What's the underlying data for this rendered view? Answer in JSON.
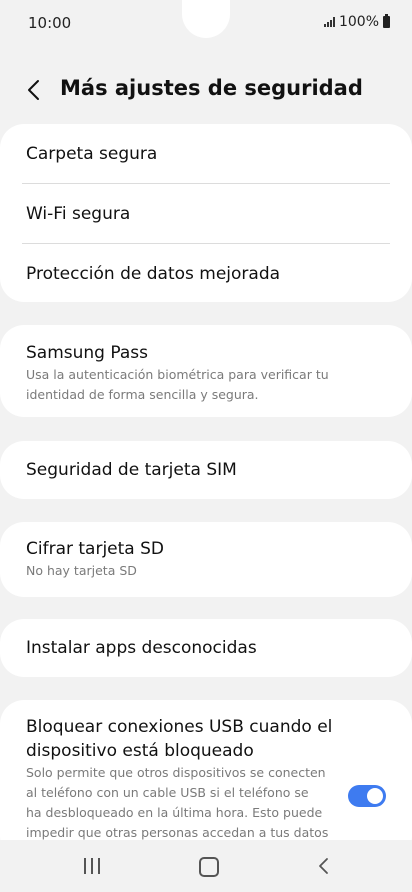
{
  "status_bar": {
    "time": "10:00",
    "battery_text": "100%"
  },
  "header": {
    "title": "Más ajustes de seguridad",
    "back_icon": "chevron-left-icon"
  },
  "group1": {
    "items": [
      {
        "title": "Carpeta segura"
      },
      {
        "title": "Wi-Fi segura"
      },
      {
        "title": "Protección de datos mejorada"
      }
    ]
  },
  "samsung_pass": {
    "title": "Samsung Pass",
    "subtitle_line1": "Usa la autenticación biométrica para verificar tu",
    "subtitle_line2": "identidad de forma sencilla y segura."
  },
  "sim_security": {
    "title": "Seguridad de tarjeta SIM"
  },
  "sd_encrypt": {
    "title": "Cifrar tarjeta SD",
    "subtitle": "No hay tarjeta SD"
  },
  "unknown_apps": {
    "title": "Instalar apps desconocidas"
  },
  "usb_block": {
    "title_line1": "Bloquear conexiones USB cuando el",
    "title_line2": "dispositivo está bloqueado",
    "desc_line1": "Solo permite que otros dispositivos se conecten",
    "desc_line2": "al teléfono con un cable USB si el teléfono se",
    "desc_line3": "ha desbloqueado en la última hora. Esto puede",
    "desc_line4": "impedir que otras personas accedan a tus datos",
    "toggle_on": true
  },
  "colors": {
    "accent": "#3e7bf0",
    "background": "#f2f2f2",
    "card": "#ffffff"
  }
}
